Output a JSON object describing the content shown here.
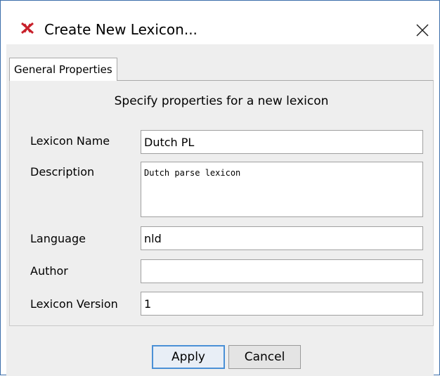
{
  "window": {
    "title": "Create New Lexicon...",
    "app_icon": "xlingpaper-x-icon",
    "close_icon": "close-icon"
  },
  "tabs": [
    {
      "label": "General Properties",
      "selected": true
    }
  ],
  "form": {
    "subtitle": "Specify properties for a new lexicon",
    "lexicon_name": {
      "label": "Lexicon Name",
      "value": "Dutch PL"
    },
    "description": {
      "label": "Description",
      "value": "Dutch parse lexicon"
    },
    "language": {
      "label": "Language",
      "value": "nld"
    },
    "author": {
      "label": "Author",
      "value": ""
    },
    "lexicon_version": {
      "label": "Lexicon Version",
      "value": "1"
    }
  },
  "buttons": {
    "apply": "Apply",
    "cancel": "Cancel"
  },
  "colors": {
    "window_border": "#3c6eaa",
    "dialog_background": "#eeeeee",
    "default_button_border": "#4a90d6",
    "icon_red": "#c8202a"
  }
}
